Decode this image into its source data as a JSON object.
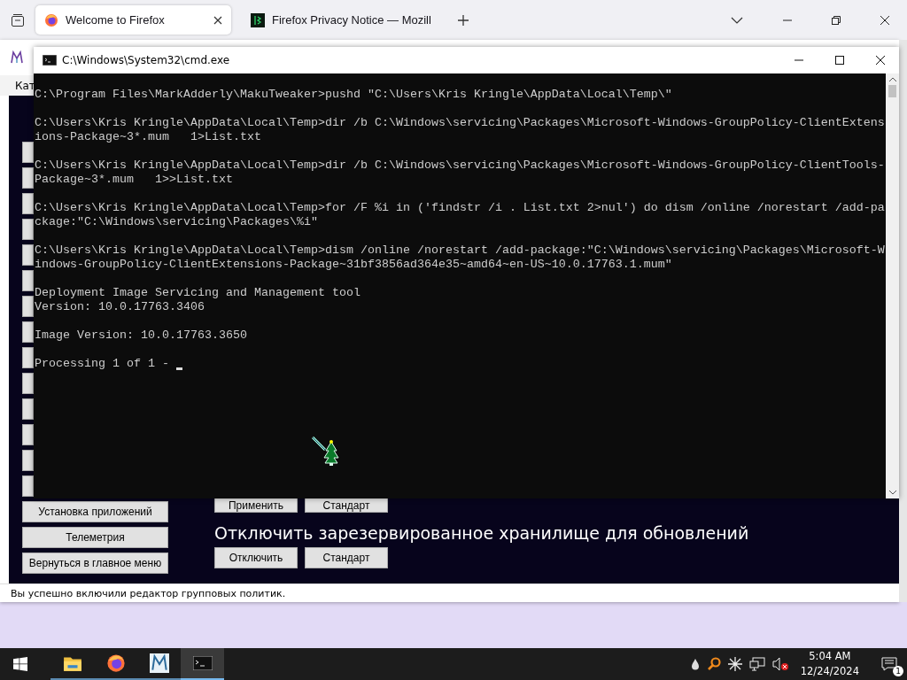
{
  "browser": {
    "tabs": [
      {
        "title": "Welcome to Firefox",
        "kind": "firefox",
        "selected": true
      },
      {
        "title": "Firefox Privacy Notice — Mozill",
        "kind": "mozilla",
        "selected": false
      }
    ]
  },
  "tweaker": {
    "menu": "Кат",
    "menu_buttons": [
      {
        "kind": "covered"
      },
      {
        "kind": "covered"
      },
      {
        "kind": "covered"
      },
      {
        "kind": "covered"
      },
      {
        "kind": "covered"
      },
      {
        "kind": "covered"
      },
      {
        "kind": "covered"
      },
      {
        "kind": "covered"
      },
      {
        "kind": "covered"
      },
      {
        "kind": "covered"
      },
      {
        "kind": "covered"
      },
      {
        "kind": "covered"
      },
      {
        "kind": "covered"
      },
      {
        "kind": "covered"
      },
      {
        "kind": "label",
        "label": "Установка приложений"
      },
      {
        "kind": "label",
        "label": "Телеметрия"
      },
      {
        "kind": "label",
        "label": "Вернуться в главное меню"
      }
    ],
    "sections": [
      {
        "buttons": [
          "Применить",
          "Стандарт"
        ]
      },
      {
        "heading": "Отключить зарезервированное хранилище для обновлений",
        "buttons": [
          "Отключить",
          "Стандарт"
        ]
      }
    ],
    "status": "Вы успешно включили редактор групповых политик."
  },
  "console": {
    "title": "C:\\Windows\\System32\\cmd.exe",
    "blocks": [
      [
        "C:\\Program Files\\MarkAdderly\\MakuTweaker>pushd \"C:\\Users\\Kris Kringle\\AppData\\Local\\Temp\\\""
      ],
      [
        "C:\\Users\\Kris Kringle\\AppData\\Local\\Temp>dir /b C:\\Windows\\servicing\\Packages\\Microsoft-Windows-GroupPolicy-ClientExtens",
        "ions-Package~3*.mum   1>List.txt"
      ],
      [
        "C:\\Users\\Kris Kringle\\AppData\\Local\\Temp>dir /b C:\\Windows\\servicing\\Packages\\Microsoft-Windows-GroupPolicy-ClientTools-",
        "Package~3*.mum   1>>List.txt"
      ],
      [
        "C:\\Users\\Kris Kringle\\AppData\\Local\\Temp>for /F %i in ('findstr /i . List.txt 2>nul') do dism /online /norestart /add-pa",
        "ckage:\"C:\\Windows\\servicing\\Packages\\%i\""
      ],
      [
        "C:\\Users\\Kris Kringle\\AppData\\Local\\Temp>dism /online /norestart /add-package:\"C:\\Windows\\servicing\\Packages\\Microsoft-W",
        "indows-GroupPolicy-ClientExtensions-Package~31bf3856ad364e35~amd64~en-US~10.0.17763.1.mum\""
      ],
      [
        "Deployment Image Servicing and Management tool",
        "Version: 10.0.17763.3406"
      ],
      [
        "Image Version: 10.0.17763.3650"
      ],
      [
        "Processing 1 of 1 - "
      ]
    ]
  },
  "taskbar": {
    "apps": [
      {
        "kind": "folder",
        "selected": false
      },
      {
        "kind": "firefox",
        "selected": false
      },
      {
        "kind": "tweaker",
        "selected": false
      },
      {
        "kind": "terminal",
        "selected": true
      }
    ],
    "time": "5:04 AM",
    "date": "12/24/2024",
    "notifications": "1"
  }
}
